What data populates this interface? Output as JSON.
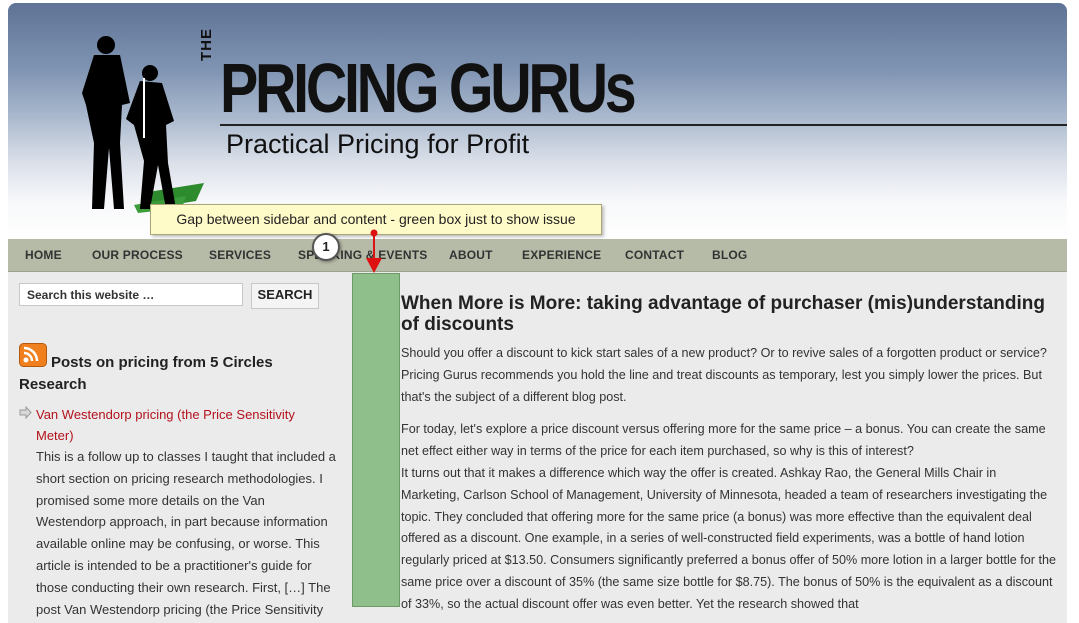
{
  "header": {
    "logo_the": "THE",
    "logo_title": "PRICING GURUs",
    "tagline": "Practical Pricing for Profit"
  },
  "nav": {
    "items": [
      "HOME",
      "OUR PROCESS",
      "SERVICES",
      "SPEAKING & EVENTS",
      "ABOUT",
      "EXPERIENCE",
      "CONTACT",
      "BLOG"
    ]
  },
  "sidebar": {
    "search_placeholder": "Search this website …",
    "search_button": "SEARCH",
    "widget_title": "Posts on pricing from 5 Circles Research",
    "post_link": "Van Westendorp pricing (the Price Sensitivity Meter)",
    "post_excerpt": "This is a follow up to classes I taught that included a short section on pricing research methodologies. I promised some more details on the Van Westendorp approach, in part because information available online may be confusing, or worse. This article is intended to be a practitioner's guide for those conducting their own research. First, […] The post Van Westendorp pricing (the Price Sensitivity"
  },
  "post": {
    "title": "When More is More: taking advantage of purchaser (mis)understanding of discounts",
    "p1": "Should you offer a discount to kick start sales of a new product? Or to revive sales of a forgotten product or service? Pricing Gurus recommends you hold the line and treat discounts as temporary, lest you simply lower the prices. But that's the subject of a different blog post.",
    "p2": "For today, let's explore a price discount versus offering more for the same price – a bonus. You can create the same net effect either way in terms of the price for each item purchased, so why is this of interest?",
    "p3": "It turns out that it makes a difference which way the offer is created. Ashkay Rao, the General Mills Chair in Marketing, Carlson School of Management, University of Minnesota, headed a team of researchers investigating the topic. They concluded that offering more for the same price (a bonus) was more effective than the equivalent deal offered as a discount. One example, in a series of well-constructed field experiments, was a bottle of hand lotion regularly priced at $13.50. Consumers significantly preferred a bonus offer of 50% more lotion in a larger bottle for the same price over a discount of 35% (the same size bottle for $8.75). The bonus of 50% is the equivalent as a discount of 33%, so the actual discount offer was even better. Yet the research showed that"
  },
  "annotation": {
    "callout": "Gap between sidebar and content - green box just to show issue",
    "step": "1"
  },
  "colors": {
    "gap_box": "#8fbf8a",
    "link": "#b3121c",
    "nav_bg": "#b6bba7",
    "callout_bg": "#fffbc9",
    "connector": "#dd1111"
  }
}
